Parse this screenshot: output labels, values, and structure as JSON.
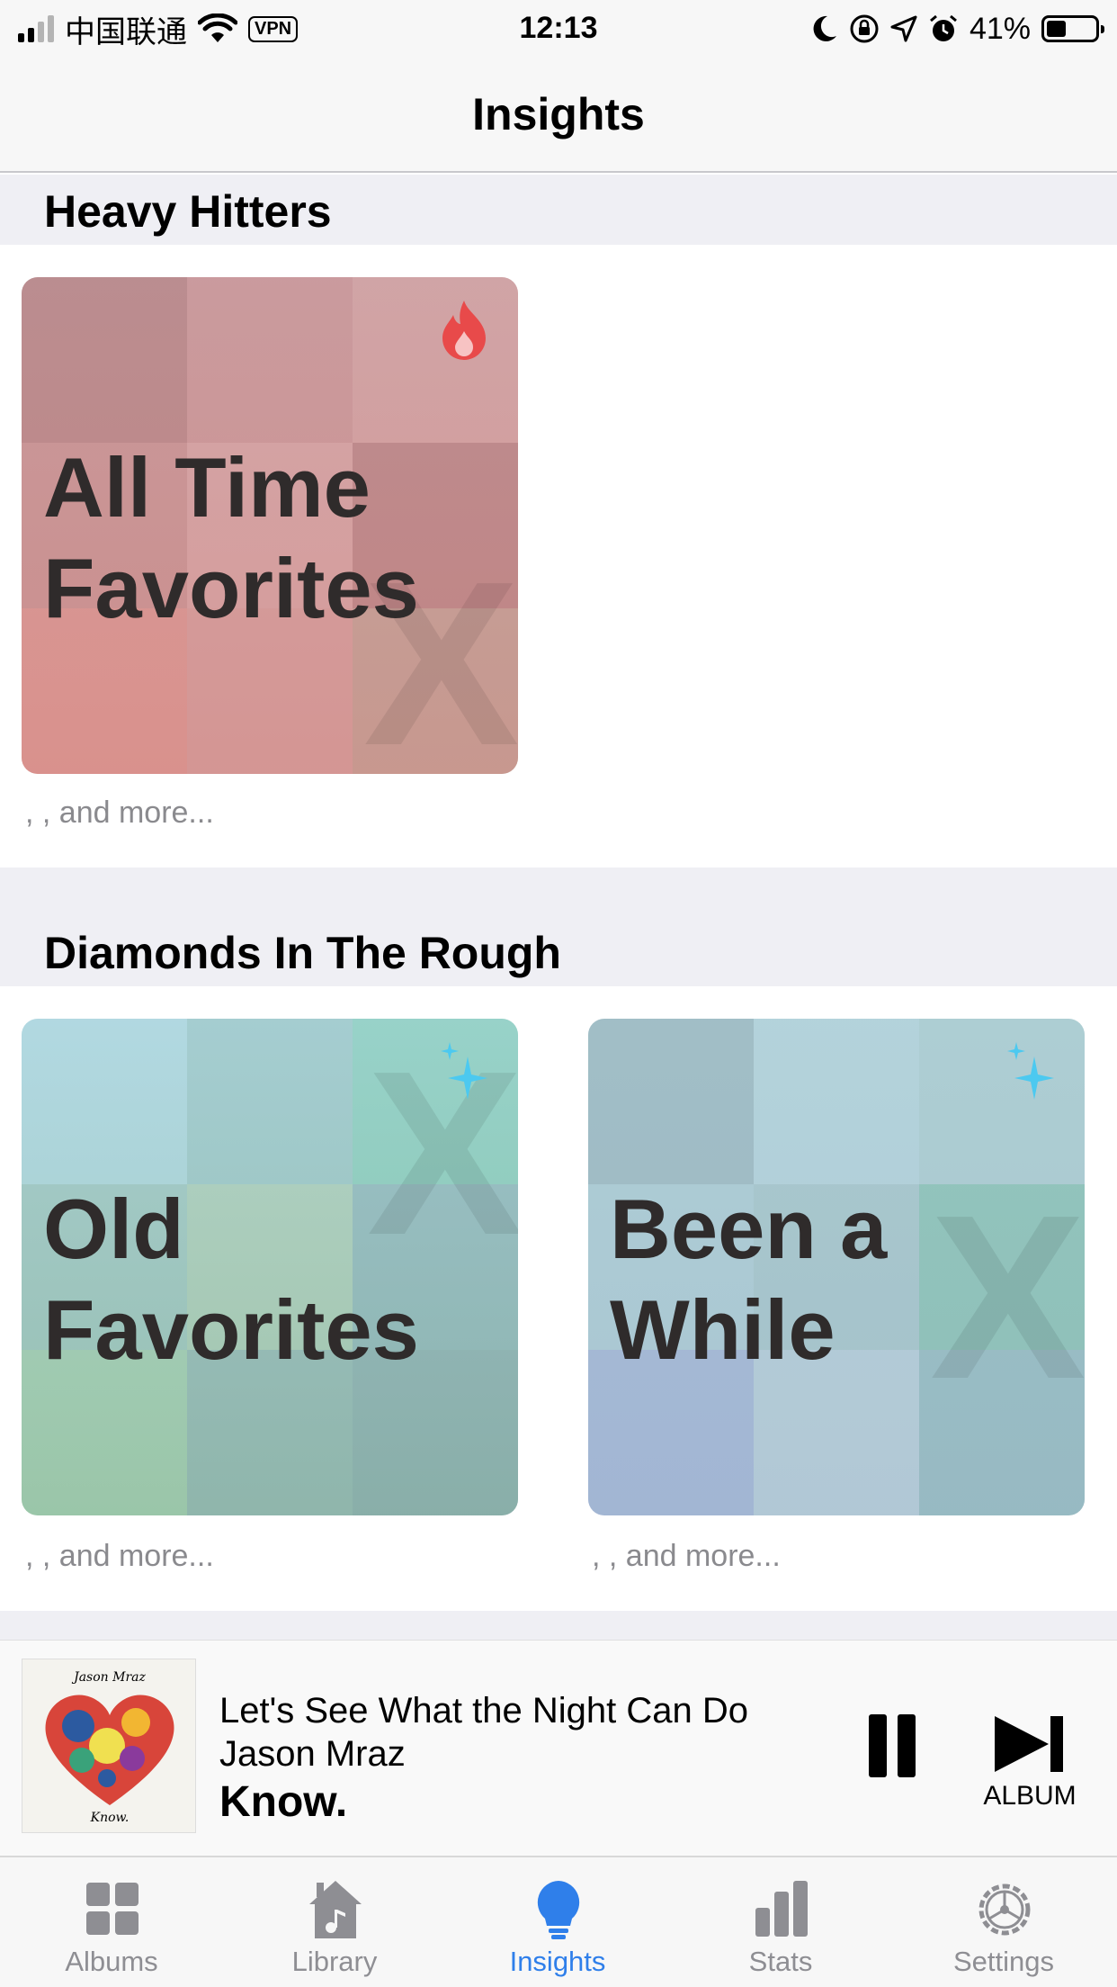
{
  "status_bar": {
    "carrier": "中国联通",
    "vpn": "VPN",
    "time": "12:13",
    "battery_percent": "41%",
    "battery_level": 0.41,
    "icons": [
      "signal-icon",
      "wifi-icon",
      "moon-icon",
      "rotation-lock-icon",
      "location-arrow-icon",
      "alarm-icon",
      "battery-icon"
    ]
  },
  "nav": {
    "title": "Insights"
  },
  "sections": [
    {
      "header": "Heavy Hitters",
      "cards": [
        {
          "title_line1": "All Time",
          "title_line2": "Favorites",
          "icon": "flame-icon",
          "more": ", , and more..."
        }
      ]
    },
    {
      "header": "Diamonds In The Rough",
      "cards": [
        {
          "title_line1": "Old",
          "title_line2": "Favorites",
          "icon": "sparkles-icon",
          "more": ", , and more..."
        },
        {
          "title_line1": "Been a",
          "title_line2": "While",
          "icon": "sparkles-icon",
          "more": ", , and more..."
        }
      ]
    }
  ],
  "now_playing": {
    "song": "Let's See What the Night Can Do",
    "artist": "Jason Mraz",
    "album": "Know.",
    "art_artist_text": "Jason Mraz",
    "art_album_text": "Know.",
    "next_label": "ALBUM"
  },
  "tabs": [
    {
      "label": "Albums",
      "icon": "albums-grid-icon",
      "active": false
    },
    {
      "label": "Library",
      "icon": "library-house-icon",
      "active": false
    },
    {
      "label": "Insights",
      "icon": "lightbulb-icon",
      "active": true
    },
    {
      "label": "Stats",
      "icon": "bar-chart-icon",
      "active": false
    },
    {
      "label": "Settings",
      "icon": "gear-icon",
      "active": false
    }
  ],
  "colors": {
    "accent": "#2f7fea",
    "inactive_tab": "#8e8e93",
    "flame": "#e84a4a",
    "sparkle": "#4cc9f0",
    "section_bg": "#efeff4"
  }
}
